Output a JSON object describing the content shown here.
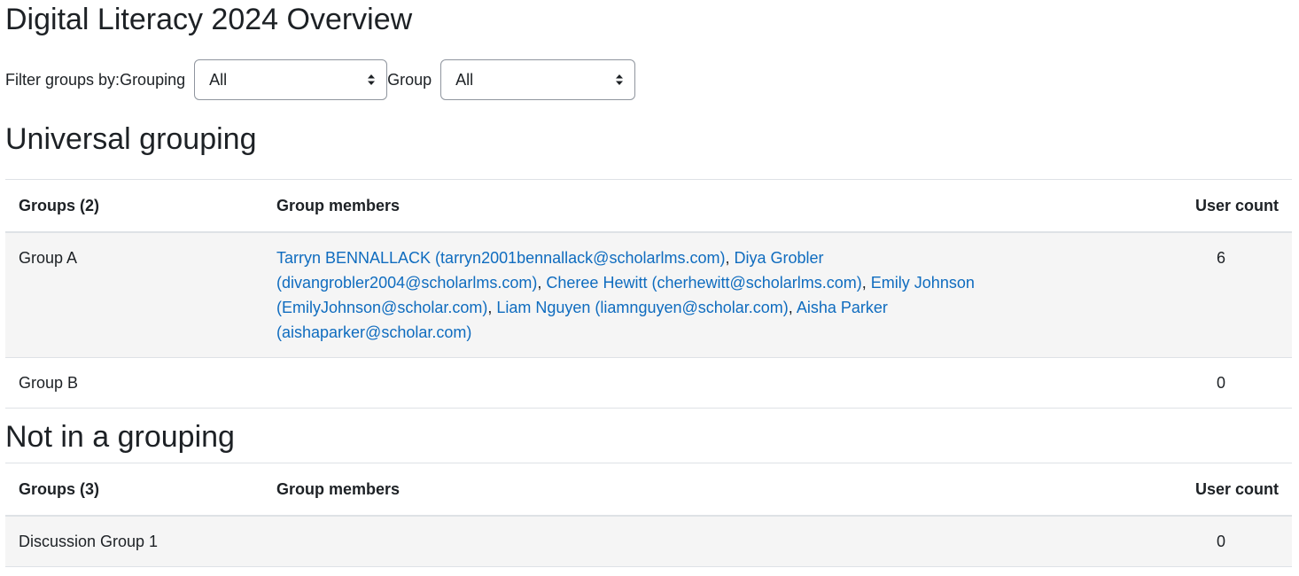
{
  "page": {
    "title": "Digital Literacy 2024 Overview"
  },
  "filters": {
    "prefix_label": "Filter groups by:",
    "grouping_label": "Grouping",
    "grouping_value": "All",
    "group_label": "Group",
    "group_value": "All"
  },
  "sections": [
    {
      "title": "Universal grouping",
      "headers": {
        "groups": "Groups (2)",
        "members": "Group members",
        "count": "User count"
      },
      "rows": [
        {
          "name": "Group A",
          "members": [
            "Tarryn BENNALLACK (tarryn2001bennallack@scholarlms.com)",
            "Diya Grobler (divangrobler2004@scholarlms.com)",
            "Cheree Hewitt (cherhewitt@scholarlms.com)",
            "Emily Johnson (EmilyJohnson@scholar.com)",
            "Liam Nguyen (liamnguyen@scholar.com)",
            "Aisha Parker (aishaparker@scholar.com)"
          ],
          "count": "6"
        },
        {
          "name": "Group B",
          "members": [],
          "count": "0"
        }
      ]
    },
    {
      "title": "Not in a grouping",
      "headers": {
        "groups": "Groups (3)",
        "members": "Group members",
        "count": "User count"
      },
      "rows": [
        {
          "name": "Discussion Group 1",
          "members": [],
          "count": "0"
        }
      ]
    }
  ],
  "colors": {
    "link": "#0f6cbf",
    "text": "#1d2125",
    "stripe": "#f5f5f5",
    "border": "#dee2e6"
  },
  "icons": {
    "select_caret": "sort-caret-icon"
  }
}
